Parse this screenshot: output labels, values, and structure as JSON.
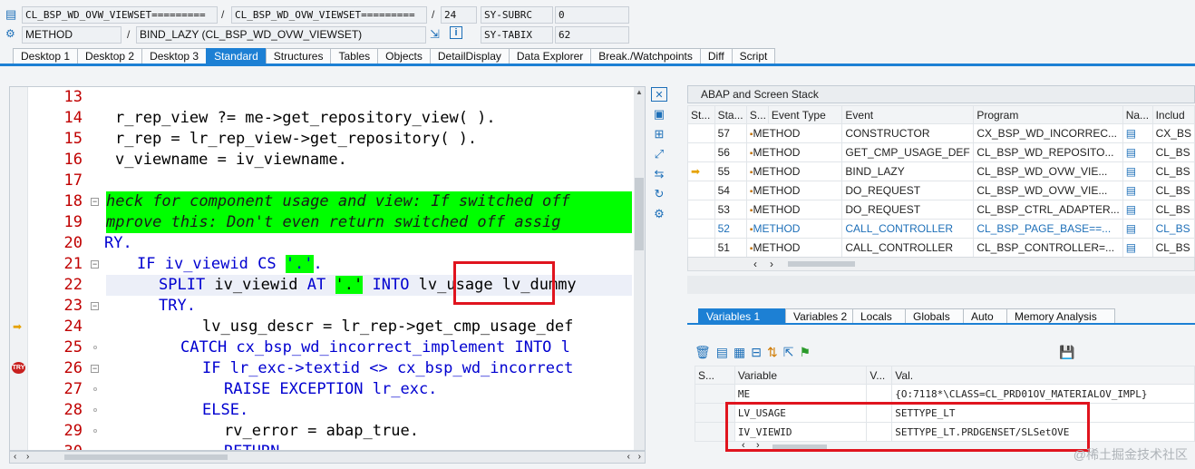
{
  "header": {
    "row1": {
      "class_a": "CL_BSP_WD_OVW_VIEWSET=========",
      "class_b": "CL_BSP_WD_OVW_VIEWSET=========",
      "line_no": "24",
      "sysfield": "SY-SUBRC",
      "sysvalue": "0"
    },
    "row2": {
      "kind": "METHOD",
      "method": "BIND_LAZY (CL_BSP_WD_OVW_VIEWSET)",
      "sysfield": "SY-TABIX",
      "sysvalue": "62"
    },
    "separator": "/"
  },
  "tabs": [
    "Desktop 1",
    "Desktop 2",
    "Desktop 3",
    "Standard",
    "Structures",
    "Tables",
    "Objects",
    "DetailDisplay",
    "Data Explorer",
    "Break./Watchpoints",
    "Diff",
    "Script"
  ],
  "active_tab": "Standard",
  "code": {
    "lines": [
      {
        "n": "13",
        "html": ""
      },
      {
        "n": "14",
        "html": "r_rep_view ?= me->get_repository_view( )."
      },
      {
        "n": "15",
        "html": "r_rep = lr_rep_view->get_repository( )."
      },
      {
        "n": "16",
        "html": "v_viewname = iv_viewname."
      },
      {
        "n": "17",
        "html": ""
      },
      {
        "n": "18",
        "html": "heck for component usage and view: If switched off"
      },
      {
        "n": "19",
        "html": "mprove this: Don't even return switched off assig"
      },
      {
        "n": "20",
        "html": "RY."
      },
      {
        "n": "21",
        "html": "IF iv_viewid CS '.'."
      },
      {
        "n": "22",
        "html": "SPLIT iv_viewid AT '.' INTO lv_usage lv_dummy"
      },
      {
        "n": "23",
        "html": "TRY."
      },
      {
        "n": "24",
        "html": "lv_usg_descr = lr_rep->get_cmp_usage_def"
      },
      {
        "n": "25",
        "html": "CATCH cx_bsp_wd_incorrect_implement INTO l"
      },
      {
        "n": "26",
        "html": "IF lr_exc->textid <> cx_bsp_wd_incorrect"
      },
      {
        "n": "27",
        "html": "RAISE EXCEPTION lr_exc."
      },
      {
        "n": "28",
        "html": "ELSE."
      },
      {
        "n": "29",
        "html": "rv_error = abap_true."
      },
      {
        "n": "30",
        "html": "RETURN"
      }
    ]
  },
  "stack": {
    "title": "ABAP and Screen Stack",
    "columns": [
      "St...",
      "Sta...",
      "S...",
      "Event Type",
      "Event",
      "Program",
      "Na...",
      "Includ"
    ],
    "rows": [
      {
        "stack": "57",
        "type": "METHOD",
        "event": "CONSTRUCTOR",
        "program": "CX_BSP_WD_INCORREC...",
        "inc": "CX_BS"
      },
      {
        "stack": "56",
        "type": "METHOD",
        "event": "GET_CMP_USAGE_DEF",
        "program": "CL_BSP_WD_REPOSITO...",
        "inc": "CL_BS"
      },
      {
        "stack": "55",
        "type": "METHOD",
        "event": "BIND_LAZY",
        "program": "CL_BSP_WD_OVW_VIE...",
        "inc": "CL_BS"
      },
      {
        "stack": "54",
        "type": "METHOD",
        "event": "DO_REQUEST",
        "program": "CL_BSP_WD_OVW_VIE...",
        "inc": "CL_BS"
      },
      {
        "stack": "53",
        "type": "METHOD",
        "event": "DO_REQUEST",
        "program": "CL_BSP_CTRL_ADAPTER...",
        "inc": "CL_BS"
      },
      {
        "stack": "52",
        "type": "METHOD",
        "event": "CALL_CONTROLLER",
        "program": "CL_BSP_PAGE_BASE==...",
        "inc": "CL_BS"
      },
      {
        "stack": "51",
        "type": "METHOD",
        "event": "CALL_CONTROLLER",
        "program": "CL_BSP_CONTROLLER=...",
        "inc": "CL_BS"
      }
    ]
  },
  "vartabs": [
    "Variables 1",
    "Variables 2",
    "Locals",
    "Globals",
    "Auto",
    "Memory Analysis"
  ],
  "active_vartab": "Variables 1",
  "variables": {
    "columns": [
      "S...",
      "Variable",
      "V...",
      "Val."
    ],
    "rows": [
      {
        "name": "ME",
        "value": "{O:7118*\\CLASS=CL_PRD01OV_MATERIALOV_IMPL}"
      },
      {
        "name": "LV_USAGE",
        "value": "SETTYPE_LT"
      },
      {
        "name": "IV_VIEWID",
        "value": "SETTYPE_LT.PRDGENSET/SLSetOVE"
      }
    ]
  },
  "watermark": "@稀土掘金技术社区",
  "colors": {
    "accent": "#1d80d4",
    "highlight_box": "#e0141e",
    "comment_bg": "#00ff00"
  }
}
